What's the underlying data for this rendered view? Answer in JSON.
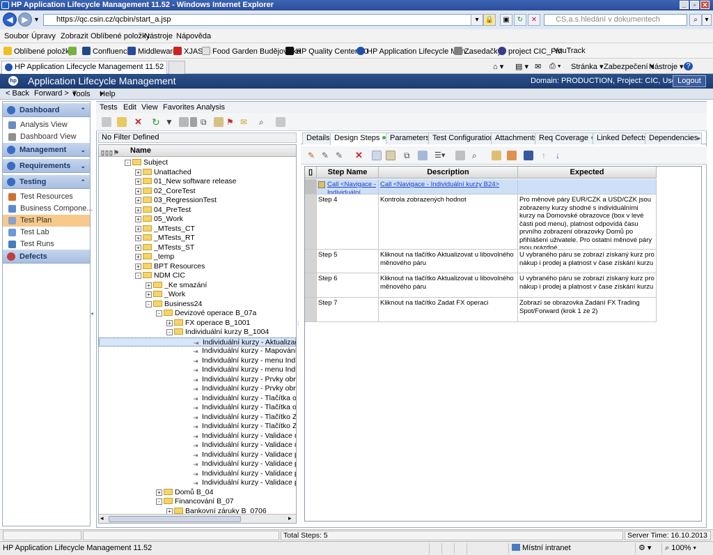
{
  "window": {
    "title": "HP Application Lifecycle Management 11.52 - Windows Internet Explorer"
  },
  "browser": {
    "url": "https://qc.csin.cz/qcbin/start_a.jsp",
    "search_placeholder": "CS,a.s.hledání v dokumentech",
    "menu": [
      "Soubor",
      "Úpravy",
      "Zobrazit",
      "Oblíbené položky",
      "Nástroje",
      "Nápověda"
    ],
    "favorites": [
      "Oblíbené položky",
      "Confluence",
      "Middleware",
      "XJAS",
      "Food Garden Budějovická",
      "HP Quality Center 10",
      "HP Application Lifecycle Man...",
      "Zasedačky",
      "project CIC_PM",
      "YouTrack"
    ],
    "tab_title": "HP Application Lifecycle Management 11.52",
    "commands": [
      "Stránka",
      "Zabezpečení",
      "Nástroje"
    ]
  },
  "alm": {
    "title": "Application Lifecycle Management",
    "domain_info": "Domain: PRODUCTION, Project: CIC, User: ertl",
    "logout": "Logout",
    "nav": [
      "< Back",
      "Forward >",
      "Tools",
      "Help"
    ]
  },
  "sidebar": {
    "groups": {
      "dashboard": "Dashboard",
      "management": "Management",
      "requirements": "Requirements",
      "testing": "Testing",
      "defects": "Defects"
    },
    "dashboard_items": [
      "Analysis View",
      "Dashboard View"
    ],
    "testing_items": [
      "Test Resources",
      "Business Compone...",
      "Test Plan",
      "Test Lab",
      "Test Runs"
    ]
  },
  "module_menu": [
    "Tests",
    "Edit",
    "View",
    "Favorites",
    "Analysis"
  ],
  "tree": {
    "filter": "No Filter Defined",
    "column": "Name",
    "nodes": [
      {
        "label": "Subject",
        "level": 0,
        "type": "folder",
        "exp": "-"
      },
      {
        "label": "Unattached",
        "level": 1,
        "type": "folder",
        "exp": "+"
      },
      {
        "label": "01_New software release",
        "level": 1,
        "type": "folder",
        "exp": "+"
      },
      {
        "label": "02_CoreTest",
        "level": 1,
        "type": "folder",
        "exp": "+"
      },
      {
        "label": "03_RegressionTest",
        "level": 1,
        "type": "folder",
        "exp": "+"
      },
      {
        "label": "04_PreTest",
        "level": 1,
        "type": "folder",
        "exp": "+"
      },
      {
        "label": "05_Work",
        "level": 1,
        "type": "folder",
        "exp": "+"
      },
      {
        "label": "_MTests_CT",
        "level": 1,
        "type": "folder",
        "exp": "+"
      },
      {
        "label": "_MTests_RT",
        "level": 1,
        "type": "folder",
        "exp": "+"
      },
      {
        "label": "_MTests_ST",
        "level": 1,
        "type": "folder",
        "exp": "+"
      },
      {
        "label": "_temp",
        "level": 1,
        "type": "folder",
        "exp": "+"
      },
      {
        "label": "BPT Resources",
        "level": 1,
        "type": "folder",
        "exp": "+"
      },
      {
        "label": "NDM CIC",
        "level": 1,
        "type": "folder",
        "exp": "-"
      },
      {
        "label": "_Ke smazání",
        "level": 2,
        "type": "folder",
        "exp": "+"
      },
      {
        "label": "_Work",
        "level": 2,
        "type": "folder",
        "exp": "+"
      },
      {
        "label": "Business24",
        "level": 2,
        "type": "folder",
        "exp": "-"
      },
      {
        "label": "Devizové operace B_07a",
        "level": 3,
        "type": "folder",
        "exp": "-"
      },
      {
        "label": "FX operace B_1001",
        "level": 4,
        "type": "folder",
        "exp": "+"
      },
      {
        "label": "Individuální kurzy B_1004",
        "level": 4,
        "type": "folder",
        "exp": "-"
      },
      {
        "label": "Individuální kurzy - Aktualizace k",
        "level": 5,
        "type": "test",
        "exp": "",
        "selected": true
      },
      {
        "label": "Individuální kurzy - Mapování ho",
        "level": 5,
        "type": "test",
        "exp": ""
      },
      {
        "label": "Individuální kurzy - menu Individ",
        "level": 5,
        "type": "test",
        "exp": ""
      },
      {
        "label": "Individuální kurzy - menu Individ",
        "level": 5,
        "type": "test",
        "exp": ""
      },
      {
        "label": "Individuální kurzy - Prvky obrazov",
        "level": 5,
        "type": "test",
        "exp": ""
      },
      {
        "label": "Individuální kurzy - Prvky obrazo",
        "level": 5,
        "type": "test",
        "exp": ""
      },
      {
        "label": "Individuální kurzy - Tlačítka obra",
        "level": 5,
        "type": "test",
        "exp": ""
      },
      {
        "label": "Individuální kurzy - Tlačítka obra",
        "level": 5,
        "type": "test",
        "exp": ""
      },
      {
        "label": "Individuální kurzy - Tlačítko Zad",
        "level": 5,
        "type": "test",
        "exp": ""
      },
      {
        "label": "Individuální kurzy - Tlačítko Zad",
        "level": 5,
        "type": "test",
        "exp": ""
      },
      {
        "label": "Individuální kurzy - Validace měn",
        "level": 5,
        "type": "test",
        "exp": ""
      },
      {
        "label": "Individuální kurzy - Validace na r",
        "level": 5,
        "type": "test",
        "exp": ""
      },
      {
        "label": "Individuální kurzy - Validace při c",
        "level": 5,
        "type": "test",
        "exp": ""
      },
      {
        "label": "Individuální kurzy - Validace při c",
        "level": 5,
        "type": "test",
        "exp": ""
      },
      {
        "label": "Individuální kurzy - Validace při p",
        "level": 5,
        "type": "test",
        "exp": ""
      },
      {
        "label": "Individuální kurzy - Validace při p",
        "level": 5,
        "type": "test",
        "exp": ""
      },
      {
        "label": "Domů B_04",
        "level": 3,
        "type": "folder",
        "exp": "+"
      },
      {
        "label": "Financování B_07",
        "level": 3,
        "type": "folder",
        "exp": "-"
      },
      {
        "label": "Bankovní záruky B_0706",
        "level": 4,
        "type": "folder",
        "exp": "+"
      }
    ]
  },
  "tabs": [
    {
      "label": "Details",
      "dot": false,
      "active": false
    },
    {
      "label": "Design Steps",
      "dot": true,
      "active": true
    },
    {
      "label": "Parameters",
      "dot": false,
      "active": false
    },
    {
      "label": "Test Configurations",
      "dot": false,
      "active": false
    },
    {
      "label": "Attachments",
      "dot": false,
      "active": false
    },
    {
      "label": "Req Coverage",
      "dot": true,
      "active": false
    },
    {
      "label": "Linked Defects",
      "dot": false,
      "active": false
    },
    {
      "label": "Dependencies",
      "dot": false,
      "active": false
    }
  ],
  "grid": {
    "headers": {
      "step": "Step Name",
      "description": "Description",
      "expected": "Expected"
    },
    "rows": [
      {
        "step": "Call <Navigace - Individuální...",
        "description": "Call <Navigace - Individuální kurzy B24>",
        "expected": "",
        "link": true,
        "selected": true
      },
      {
        "step": "Step 4",
        "description": "Kontrola zobrazených hodnot",
        "expected": "Pro měnové páry EUR/CZK a USD/CZK jsou zobrazeny kurzy shodné s individuálními kurzy na Domovské obrazovce (box v levé části pod menu), platnost odpovídá času prvního zobrazení obrazovky Domů po přihlášení uživatele. Pro ostatní měnové páry jsou prázdné."
      },
      {
        "step": "Step 5",
        "description": "Kliknout na tlačítko Aktualizovat u libovolného měnového páru",
        "expected": "U vybraného páru se zobrazí získaný kurz pro nákup i prodej a platnost v čase získání kurzu"
      },
      {
        "step": "Step 6",
        "description": "Kliknout na tlačítko Aktualizovat u libovolného měnového páru",
        "expected": "U vybraného páru se zobrazí získaný kurz pro nákup i prodej a platnost v čase získání kurzu"
      },
      {
        "step": "Step 7",
        "description": "Kliknout na tlačítko Zadat FX operaci",
        "expected": "Zobrazí se obrazovka Zadání FX Trading Spot/Forward (krok 1 ze 2)"
      }
    ]
  },
  "status": {
    "total_steps": "Total Steps: 5",
    "server_time": "Server Time: 16.10.2013 9:35",
    "ie_left": "HP Application Lifecycle Management 11.52",
    "zone": "Místní intranet",
    "zoom": "100%"
  }
}
